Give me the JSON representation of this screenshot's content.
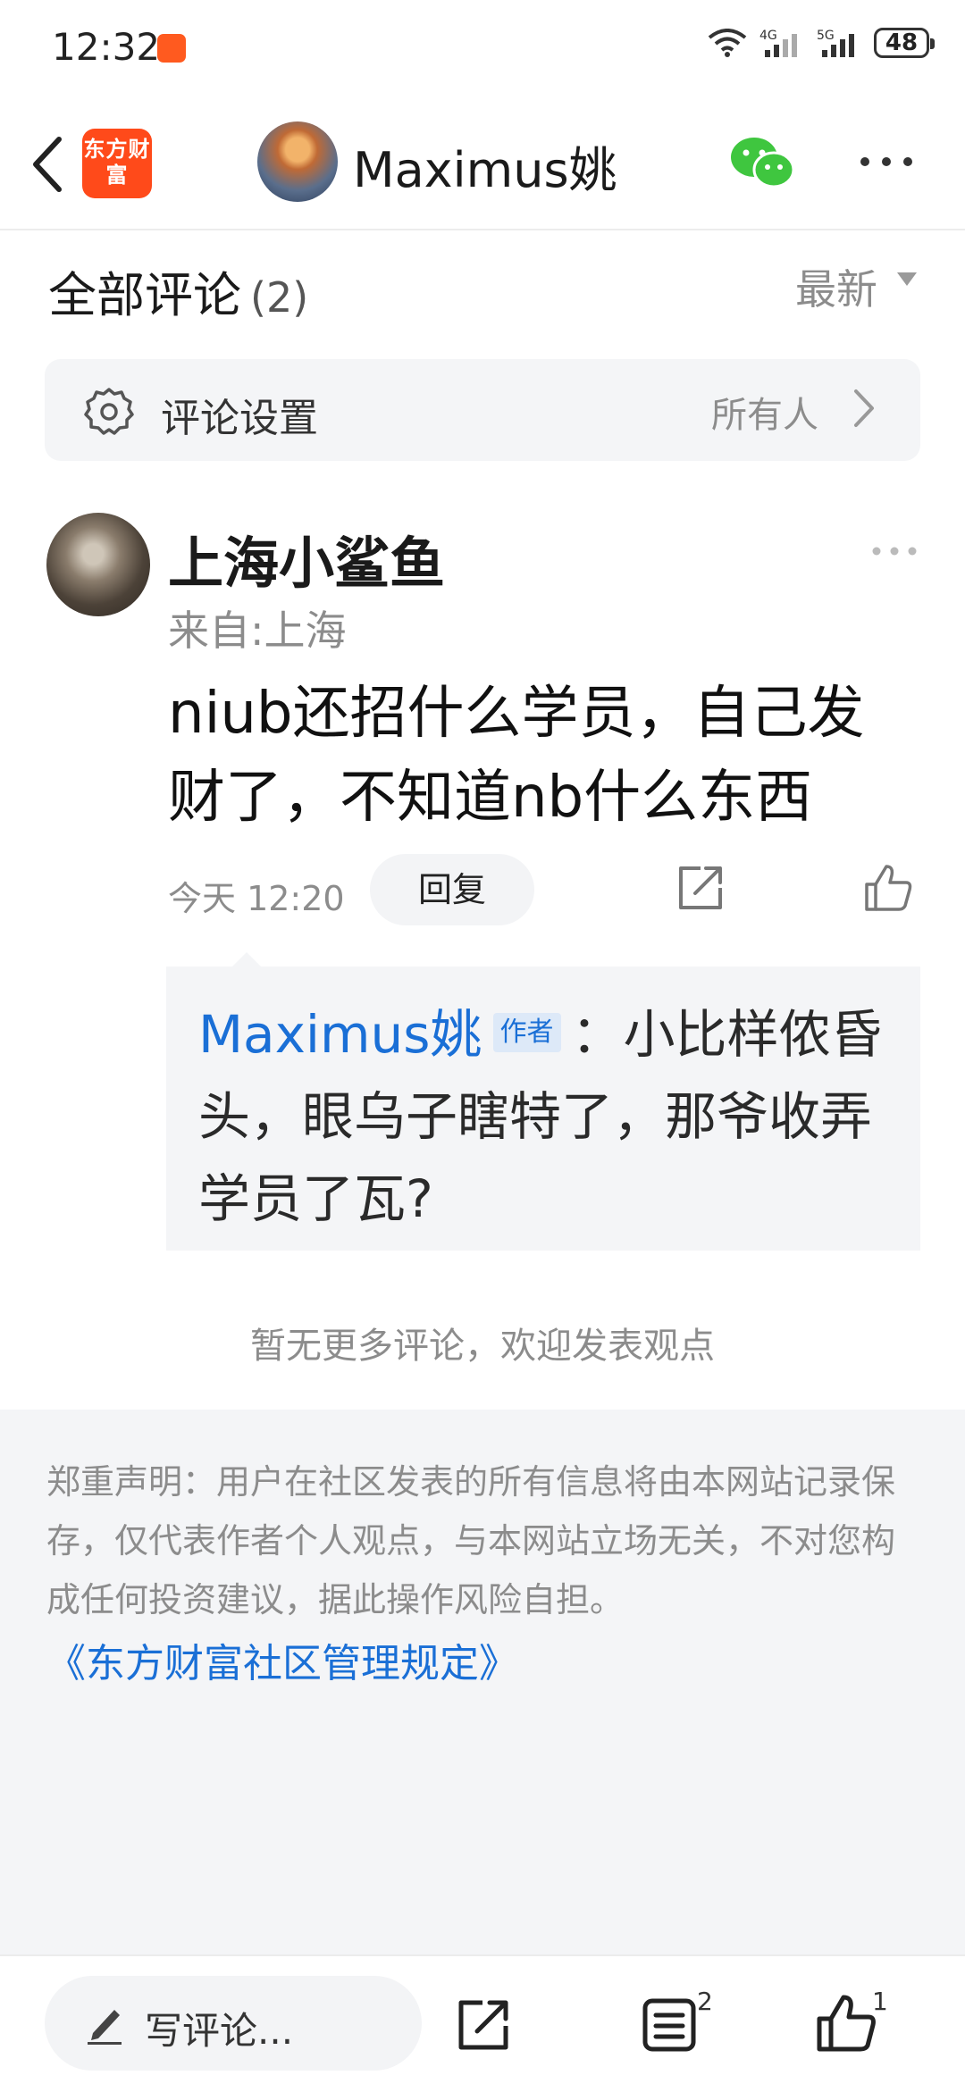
{
  "status_bar": {
    "time": "12:32",
    "battery": "48",
    "network_4g": "4G",
    "network_5g": "5G"
  },
  "header": {
    "brand_logo_text": "东方财富",
    "title": "Maximus姚"
  },
  "section": {
    "title": "全部评论",
    "count": "(2)",
    "sort": "最新"
  },
  "settings": {
    "label": "评论设置",
    "value": "所有人"
  },
  "comment": {
    "user": "上海小鲨鱼",
    "location": "来自:上海",
    "text": "niub还招什么学员，自己发财了，不知道nb什么东西",
    "time": "今天 12:20",
    "reply_button": "回复"
  },
  "reply": {
    "user": "Maximus姚",
    "badge": "作者",
    "text": "：小比样侬昏头，眼乌子瞎特了，那爷收弄学员了瓦?"
  },
  "no_more_text": "暂无更多评论，欢迎发表观点",
  "disclaimer": {
    "text": "郑重声明：用户在社区发表的所有信息将由本网站记录保存，仅代表作者个人观点，与本网站立场无关，不对您构成任何投资建议，据此操作风险自担。",
    "link": "《东方财富社区管理规定》"
  },
  "bottom_bar": {
    "comment_placeholder": "写评论...",
    "list_count": "2",
    "like_count": "1"
  },
  "colors": {
    "brand": "#ff4a1a",
    "link": "#1a6fd6",
    "wechat": "#3fc63f"
  }
}
